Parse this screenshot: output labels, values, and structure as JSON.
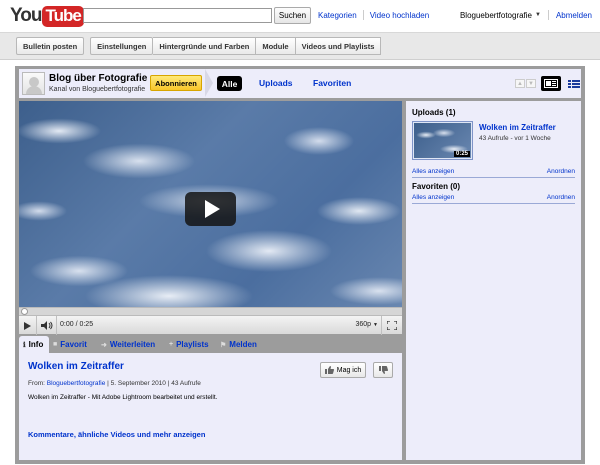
{
  "masthead": {
    "logo_you": "You",
    "logo_tube": "Tube",
    "search_value": "",
    "search_button": "Suchen",
    "links": [
      "Kategorien",
      "Video hochladen"
    ],
    "user": "Bloguebertfotografie",
    "logout": "Abmelden"
  },
  "editor_tabs": [
    "Bulletin posten",
    "Einstellungen",
    "Hintergründe und Farben",
    "Module",
    "Videos und Playlists"
  ],
  "channel": {
    "title": "Blog über Fotografie",
    "subtitle": "Kanal von Bloguebertfotografie",
    "subscribe": "Abonnieren",
    "nav": {
      "all": "Alle",
      "uploads": "Uploads",
      "favorites": "Favoriten"
    }
  },
  "player": {
    "time": "0:00 / 0:25",
    "quality": "360p",
    "progress_fraction": 0
  },
  "info_tabs": [
    "Info",
    "Favorit",
    "Weiterleiten",
    "Playlists",
    "Melden"
  ],
  "video": {
    "title": "Wolken im Zeitraffer",
    "meta_from": "From: ",
    "meta_user": "Bloguebertfotografie",
    "meta_rest": " | 5. September 2010 | 43 Aufrufe",
    "description": "Wolken im Zeitraffer - Mit Adobe Lightroom bearbeitet und erstellt.",
    "like": "Mag ich",
    "more": "Kommentare, ähnliche Videos und mehr anzeigen"
  },
  "sidebar": {
    "uploads_head": "Uploads (1)",
    "item": {
      "title": "Wolken im Zeitraffer",
      "meta": "43 Aufrufe - vor 1 Woche",
      "duration": "0:25"
    },
    "show_all": "Alles anzeigen",
    "arrange": "Anordnen",
    "favorites_head": "Favoriten (0)"
  },
  "colors": {
    "accent_link": "#0033cc",
    "panel_bg": "#ededfa",
    "frame": "#9c9c9c",
    "subscribe": "#f8c62a",
    "logo_red": "#d32626"
  }
}
